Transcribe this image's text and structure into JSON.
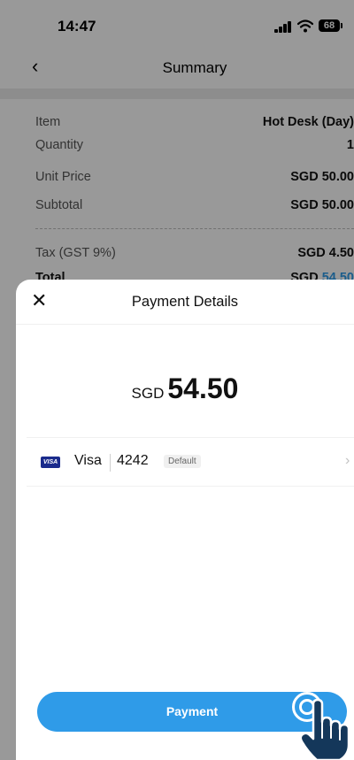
{
  "status_bar": {
    "time": "14:47",
    "battery": "68"
  },
  "nav": {
    "title": "Summary"
  },
  "summary": {
    "rows": [
      {
        "label": "Item",
        "value": "Hot Desk (Day)"
      },
      {
        "label": "Quantity",
        "value": "1"
      },
      {
        "label": "Unit Price",
        "value": "SGD 50.00"
      },
      {
        "label": "Subtotal",
        "value": "SGD 50.00"
      },
      {
        "label": "Tax (GST 9%)",
        "value": "SGD 4.50"
      }
    ],
    "total": {
      "label": "Total",
      "currency": "SGD",
      "amount": "54.50"
    }
  },
  "sheet": {
    "title": "Payment Details",
    "amount_currency": "SGD",
    "amount_value": "54.50",
    "card": {
      "logo_text": "VISA",
      "brand": "Visa",
      "last4": "4242",
      "badge": "Default"
    },
    "button_label": "Payment"
  },
  "colors": {
    "accent": "#2f9be8",
    "overlay": "rgba(0,0,0,0.40)",
    "visa_blue": "#1a2b8c"
  },
  "icons": [
    "back-icon",
    "close-icon",
    "visa-icon",
    "chevron-right-icon",
    "signal-icon",
    "wifi-icon",
    "battery-icon",
    "hand-cursor-icon"
  ]
}
